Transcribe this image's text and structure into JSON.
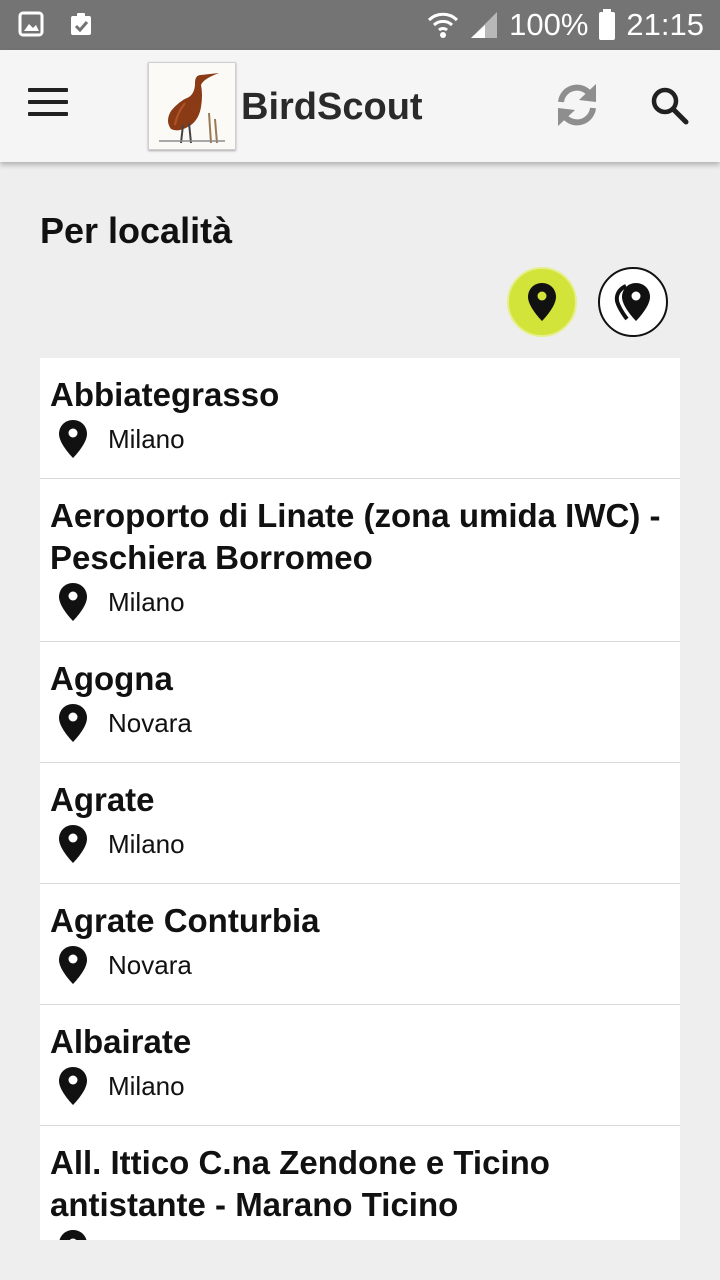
{
  "status_bar": {
    "battery": "100%",
    "time": "21:15",
    "icons": [
      "image-icon",
      "clipboard-check-icon",
      "wifi-icon",
      "signal-icon",
      "battery-icon"
    ]
  },
  "app_bar": {
    "title": "BirdScout",
    "icons": [
      "menu-icon",
      "heron-logo",
      "refresh-icon",
      "search-icon"
    ]
  },
  "section": {
    "title": "Per località"
  },
  "filters": [
    {
      "name": "single-location",
      "icon": "map-pin-icon",
      "active": true
    },
    {
      "name": "multiple-locations",
      "icon": "map-pins-icon",
      "active": false
    }
  ],
  "locations": [
    {
      "name": "Abbiategrasso",
      "province": "Milano"
    },
    {
      "name": "Aeroporto di Linate (zona umida IWC) - Peschiera Borromeo",
      "province": "Milano"
    },
    {
      "name": "Agogna",
      "province": "Novara"
    },
    {
      "name": "Agrate",
      "province": "Milano"
    },
    {
      "name": "Agrate Conturbia",
      "province": "Novara"
    },
    {
      "name": "Albairate",
      "province": "Milano"
    },
    {
      "name": "All. Ittico C.na Zendone e Ticino antistante - Marano Ticino",
      "province": ""
    }
  ],
  "colors": {
    "status_bar": "#747474",
    "app_bar": "#f5f5f5",
    "background": "#eeeeee",
    "accent": "#d2e33a",
    "text": "#111111"
  }
}
